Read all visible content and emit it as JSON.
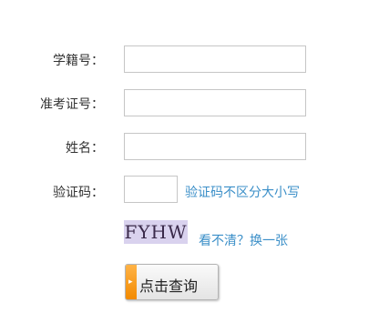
{
  "form": {
    "student_id_label": "学籍号：",
    "exam_no_label": "准考证号：",
    "name_label": "姓名：",
    "captcha_label": "验证码：",
    "captcha_hint": "验证码不区分大小写",
    "captcha_text": "FYHW",
    "refresh_captcha_link": "看不清？换一张",
    "submit_label": "点击查询",
    "student_id_value": "",
    "exam_no_value": "",
    "name_value": "",
    "captcha_value": ""
  },
  "colors": {
    "link": "#3b8fc8",
    "button_accent": "#f28a00",
    "captcha_bg": "#d9d2ee"
  },
  "icons": {
    "submit_icon": "arrow-icon"
  }
}
